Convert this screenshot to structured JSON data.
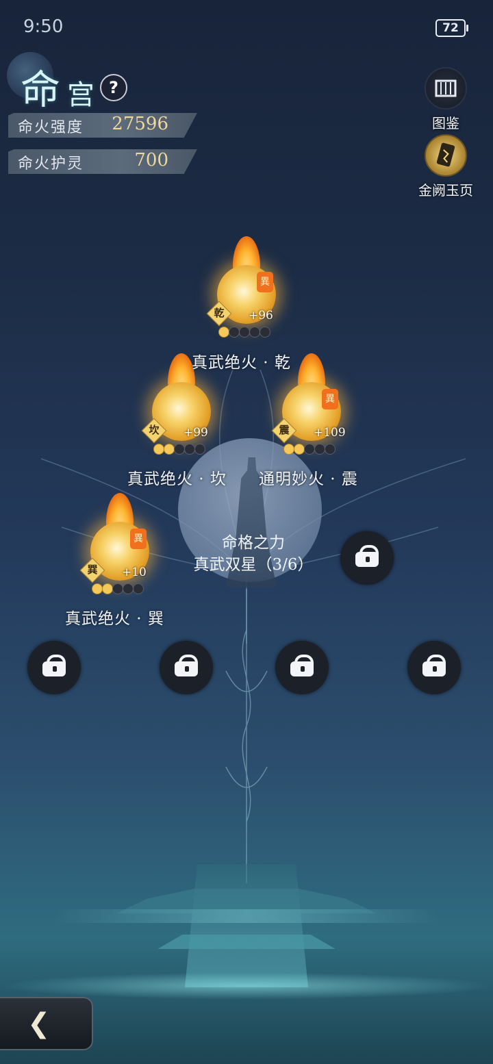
{
  "status_bar": {
    "time": "9:50",
    "battery": "72"
  },
  "header": {
    "title_main": "命",
    "title_sub": "宫",
    "help_label": "?"
  },
  "stats": [
    {
      "label": "命火强度",
      "value": "27596"
    },
    {
      "label": "命火护灵",
      "value": "700"
    }
  ],
  "side_buttons": {
    "atlas": {
      "label": "图鉴",
      "icon": "scroll-icon"
    },
    "jade": {
      "label": "金阙玉页",
      "icon": "jade-page-icon"
    }
  },
  "nodes": {
    "qian": {
      "name": "真武绝火 · 乾",
      "tag": "乾",
      "bonus": "+96",
      "badge": "異",
      "level": 1,
      "max_level": 5
    },
    "kan": {
      "name": "真武绝火 · 坎",
      "tag": "坎",
      "bonus": "+99",
      "badge": "",
      "level": 2,
      "max_level": 5
    },
    "zhen": {
      "name": "通明妙火 · 震",
      "tag": "震",
      "bonus": "+109",
      "badge": "異",
      "level": 2,
      "max_level": 5
    },
    "xun": {
      "name": "真武绝火 · 巽",
      "tag": "巽",
      "bonus": "+10",
      "badge": "異",
      "level": 2,
      "max_level": 5
    }
  },
  "fate_power": {
    "title": "命格之力",
    "subtitle": "真武双星（3/6）"
  },
  "locks": [
    "lock-icon",
    "lock-icon",
    "lock-icon",
    "lock-icon",
    "lock-icon"
  ],
  "back": {
    "icon": "back-arrow-icon",
    "glyph": "❮"
  },
  "colors": {
    "gold": "#f0d79a",
    "fire": "#ffb52e",
    "badge": "#f0701e"
  }
}
